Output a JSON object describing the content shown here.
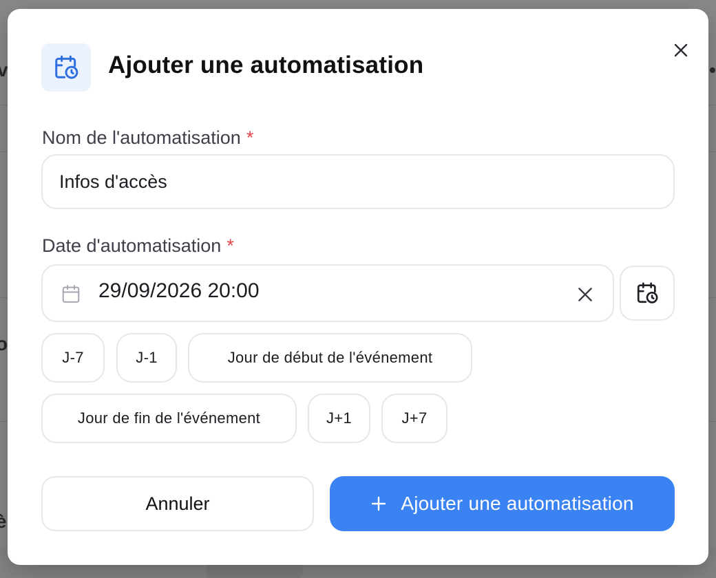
{
  "modal": {
    "title": "Ajouter une automatisation",
    "header_icon": "calendar-clock-icon",
    "close_icon": "close-icon"
  },
  "form": {
    "name_label": "Nom de l'automatisation",
    "name_required_mark": "*",
    "name_value": "Infos d'accès",
    "date_label": "Date d'automatisation",
    "date_required_mark": "*",
    "date_value": "29/09/2026 20:00",
    "date_icon": "calendar-icon",
    "clear_icon": "close-icon",
    "picker_icon": "calendar-clock-icon"
  },
  "presets": [
    {
      "label": "J-7"
    },
    {
      "label": "J-1"
    },
    {
      "label": "Jour de début de l'événement"
    },
    {
      "label": "Jour de fin de l'événement"
    },
    {
      "label": "J+1"
    },
    {
      "label": "J+7"
    }
  ],
  "actions": {
    "cancel_label": "Annuler",
    "submit_label": "Ajouter une automatisation",
    "submit_icon": "plus-icon"
  },
  "colors": {
    "primary": "#3b82f2",
    "required": "#e5484d",
    "icon_bg": "#eaf2fe"
  }
}
